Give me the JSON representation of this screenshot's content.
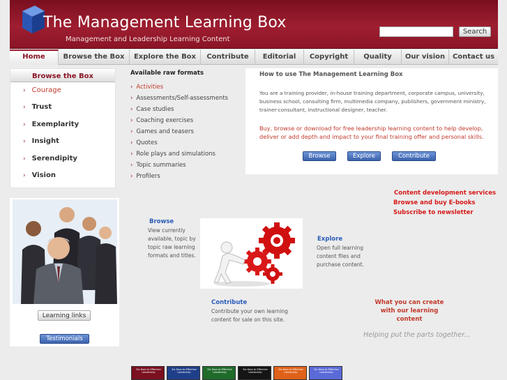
{
  "header": {
    "title": "The Management Learning Box",
    "tagline": "Management and Leadership Learning Content",
    "search_placeholder": "",
    "search_button": "Search"
  },
  "nav": {
    "items": [
      {
        "label": "Home",
        "active": true
      },
      {
        "label": "Browse the Box",
        "active": false
      },
      {
        "label": "Explore the Box",
        "active": false
      },
      {
        "label": "Contribute",
        "active": false
      },
      {
        "label": "Editorial",
        "active": false
      },
      {
        "label": "Copyright",
        "active": false
      },
      {
        "label": "Quality",
        "active": false
      },
      {
        "label": "Our vision",
        "active": false
      },
      {
        "label": "Contact us",
        "active": false
      }
    ]
  },
  "sidebar": {
    "heading": "Browse the Box",
    "items": [
      {
        "label": "Courage",
        "active": true
      },
      {
        "label": "Trust",
        "active": false
      },
      {
        "label": "Exemplarity",
        "active": false
      },
      {
        "label": "Insight",
        "active": false
      },
      {
        "label": "Serendipity",
        "active": false
      },
      {
        "label": "Vision",
        "active": false
      }
    ],
    "bullet": "›"
  },
  "formats": {
    "title": "Available raw formats",
    "items": [
      "Activities",
      "Assessments/Self-assessments",
      "Case studies",
      "Coaching exercises",
      "Games and teasers",
      "Quotes",
      "Role plays and simulations",
      "Topic summaries",
      "Profilers"
    ]
  },
  "howto": {
    "title": "How to use The Management Learning Box",
    "description": "You are a training provider, in-house training department, corporate campus, university, business school, consulting firm, multimedia company, publishers, government ministry, trainer-consultant, instructional designer, teacher.",
    "cta": "Buy, browse or download for free leadership learning content to help develop, deliver or add depth and impact to your final training offer and personal skills.",
    "buttons": {
      "browse": "Browse",
      "explore": "Explore",
      "contribute": "Contribute"
    }
  },
  "left_panel": {
    "learning_links": "Learning links",
    "testimonials": "Testimonials"
  },
  "center": {
    "browse_title": "Browse",
    "browse_desc": "View currently available, topic by topic raw learning formats and titles.",
    "explore_title": "Explore",
    "explore_desc": "Open full learning content files and purchase content.",
    "contribute_title": "Contribute",
    "contribute_desc": "Contribute your own learning content for sale on this site."
  },
  "right_links": {
    "content_dev": "Content development services",
    "ebooks": "Browse and buy E-books",
    "newsletter": "Subscribe to newsletter",
    "create": "What you can create with our learning content",
    "helping": "Helping put the parts together..."
  },
  "books": [
    {
      "title": "Six Keys to Effective Leadership",
      "color": "#7a1020"
    },
    {
      "title": "Six Keys to Effective Leadership",
      "color": "#1f3f8a"
    },
    {
      "title": "Six Keys to Effective Leadership",
      "color": "#1f6b2a"
    },
    {
      "title": "Six Keys to Effective Leadership",
      "color": "#151515"
    },
    {
      "title": "Six Keys to Effective Leadership",
      "color": "#e0621a"
    },
    {
      "title": "Six Keys to Effective Leadership",
      "color": "#5a6ad8"
    }
  ],
  "colors": {
    "brand": "#9e1e30",
    "accent_red": "#c0392b",
    "link_blue": "#2a5bb8",
    "button_blue": "#3c63ad"
  },
  "icons": {
    "logo": "blue-cube-logo",
    "bullet": "chevron-right-icon"
  }
}
